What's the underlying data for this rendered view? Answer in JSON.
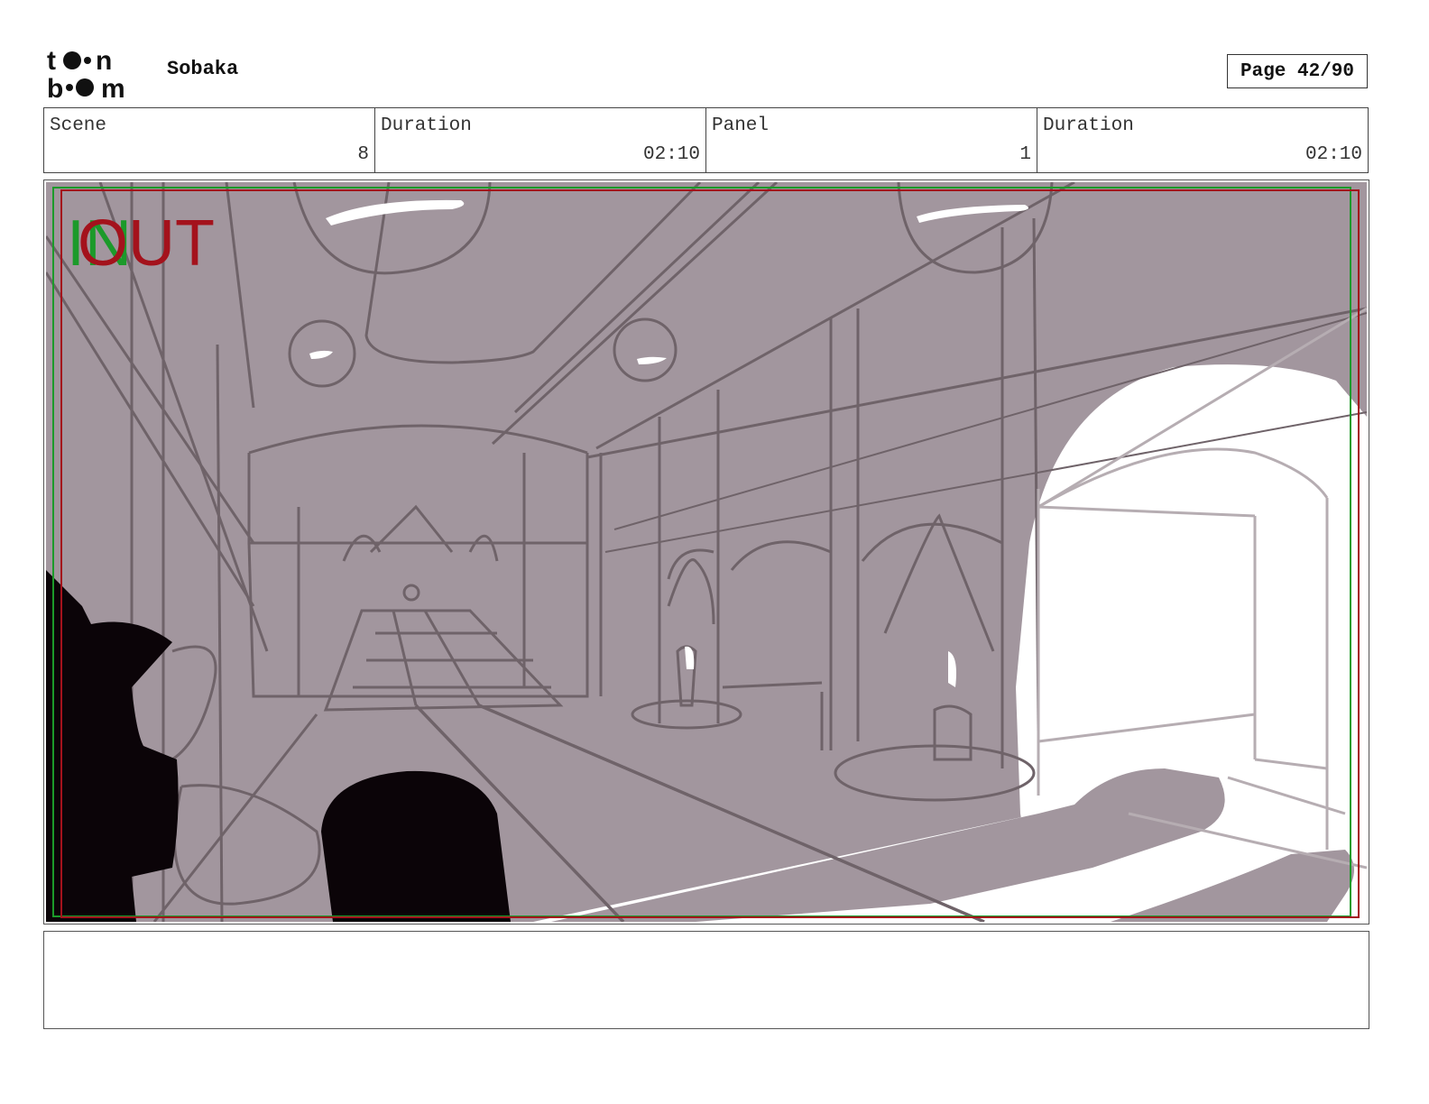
{
  "header": {
    "logo_text": "toon boom",
    "project_title": "Sobaka",
    "page_label": "Page 42/90"
  },
  "info": {
    "scene_label": "Scene",
    "scene_value": "8",
    "scene_duration_label": "Duration",
    "scene_duration_value": "02:10",
    "panel_label": "Panel",
    "panel_value": "1",
    "panel_duration_label": "Duration",
    "panel_duration_value": "02:10"
  },
  "panel": {
    "in_marker": "IN",
    "out_marker": "OUT",
    "colors": {
      "background": "#a2969e",
      "line": "#6f6369",
      "light": "#ffffff",
      "silhouette": "#0b0408",
      "in_frame": "#1c9a2a",
      "out_frame": "#a4121c"
    }
  },
  "notes": {
    "text": ""
  }
}
